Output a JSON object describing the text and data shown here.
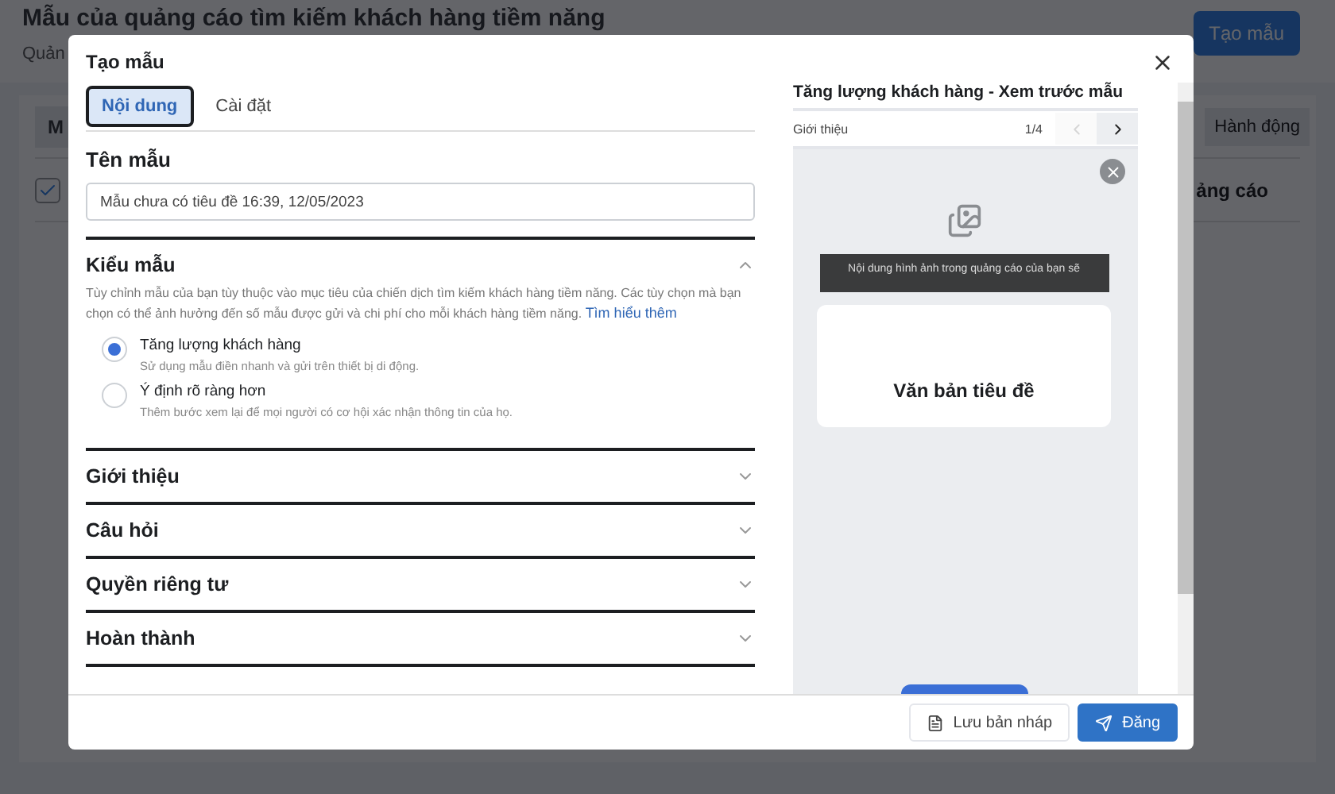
{
  "background": {
    "title": "Mẫu của quảng cáo tìm kiếm khách hàng tiềm năng",
    "subtitle": "Quản",
    "create_button": "Tạo mẫu",
    "tab": "M",
    "action_button": "Hành động",
    "column_header": "ảng cáo",
    "select_all_checked": true
  },
  "modal": {
    "title": "Tạo mẫu",
    "tabs": [
      {
        "label": "Nội dung",
        "selected": true
      },
      {
        "label": "Cài đặt",
        "selected": false
      }
    ],
    "name_label": "Tên mẫu",
    "name_value": "Mẫu chưa có tiêu đề 16:39, 12/05/2023",
    "sections": [
      {
        "title": "Kiểu mẫu",
        "expanded": true,
        "description": "Tùy chỉnh mẫu của bạn tùy thuộc vào mục tiêu của chiến dịch tìm kiếm khách hàng tiềm năng. Các tùy chọn mà bạn chọn có thể ảnh hưởng đến số mẫu được gửi và chi phí cho mỗi khách hàng tiềm năng.",
        "link": "Tìm hiểu thêm",
        "options": [
          {
            "label": "Tăng lượng khách hàng",
            "hint": "Sử dụng mẫu điền nhanh và gửi trên thiết bị di động.",
            "selected": true
          },
          {
            "label": "Ý định rõ ràng hơn",
            "hint": "Thêm bước xem lại để mọi người có cơ hội xác nhận thông tin của họ.",
            "selected": false
          }
        ]
      },
      {
        "title": "Giới thiệu",
        "expanded": false
      },
      {
        "title": "Câu hỏi",
        "expanded": false
      },
      {
        "title": "Quyền riêng tư",
        "expanded": false
      },
      {
        "title": "Hoàn thành",
        "expanded": false
      }
    ],
    "preview": {
      "title": "Tăng lượng khách hàng - Xem trước mẫu",
      "step": "Giới thiệu",
      "counter": "1/4",
      "nav": [
        {
          "kind": "prev",
          "disabled": true
        },
        {
          "kind": "next",
          "disabled": false
        }
      ],
      "image_caption": "Nội dung hình ảnh trong quảng cáo của bạn sẽ",
      "headline": "Văn bản tiêu đề"
    },
    "save_draft_button": "Lưu bản nháp",
    "publish_button": "Đăng"
  }
}
